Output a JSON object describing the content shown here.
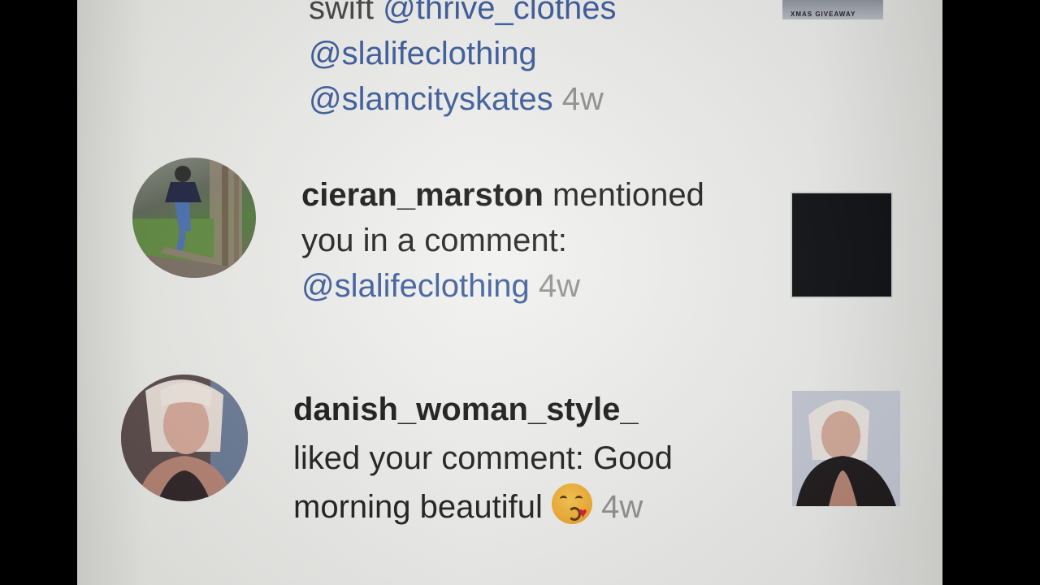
{
  "notifications": [
    {
      "lines": {
        "partial_prefix": "swift ",
        "mention_1": "@thrive_clothes",
        "mention_2": "@slalifeclothing",
        "mention_3": "@slamcityskates",
        "time": "4w"
      },
      "thumbnail_text": "XMAS GIVEAWAY"
    },
    {
      "username": "cieran_marston",
      "action": " mentioned",
      "action_line2": "you in a comment:",
      "mention": "@slalifeclothing",
      "time": "4w"
    },
    {
      "username": "danish_woman_style_",
      "action": "liked your comment: Good",
      "action_line2": "morning beautiful ",
      "emoji": "kissing-face-with-heart-emoji",
      "time": "4w"
    }
  ],
  "colors": {
    "mention": "#3a5a9a",
    "timestamp": "#8f8f8f",
    "username": "#171717",
    "background": "#efefed"
  }
}
